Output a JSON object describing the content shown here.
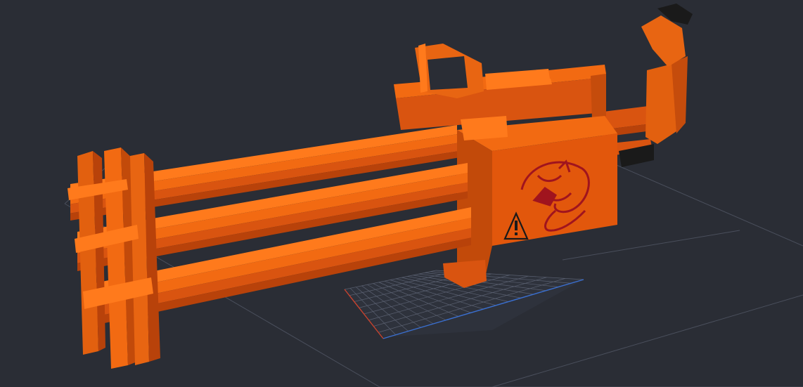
{
  "viewport": {
    "background": "#2a2d35",
    "grid_color": "#4a4f5c",
    "floor_grid_color": "#5a6070",
    "axis_x_color": "#c8422e",
    "axis_z_color": "#3a6fd0"
  },
  "model": {
    "primary_color": "#f26a12",
    "shade_dark": "#b8420a",
    "shade_mid": "#d95410",
    "shade_light": "#ff7a1c",
    "grip_color": "#1a1a1a",
    "emblem_color": "#a0141e",
    "emblem_icon": "dragon-emblem-icon",
    "warning_icon": "warning-triangle-icon"
  }
}
